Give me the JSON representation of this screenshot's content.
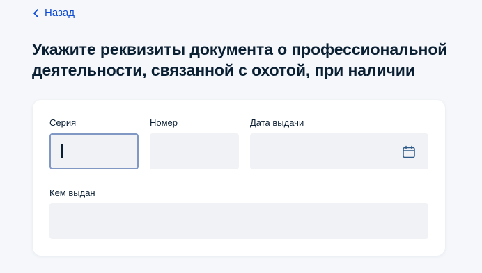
{
  "nav": {
    "back_label": "Назад"
  },
  "page": {
    "title": "Укажите реквизиты документа о профессиональной деятельности, связанной с охотой, при наличии"
  },
  "form": {
    "series": {
      "label": "Серия",
      "value": "",
      "focused": true
    },
    "number": {
      "label": "Номер",
      "value": ""
    },
    "issue_date": {
      "label": "Дата выдачи",
      "value": "",
      "icon": "calendar-icon"
    },
    "issued_by": {
      "label": "Кем выдан",
      "value": ""
    }
  },
  "colors": {
    "accent": "#0d4cd3",
    "background": "#f5f7fa",
    "card": "#ffffff",
    "input_bg": "#f0f2f6",
    "input_focus_border": "#8198c5",
    "text": "#0b1f33"
  }
}
